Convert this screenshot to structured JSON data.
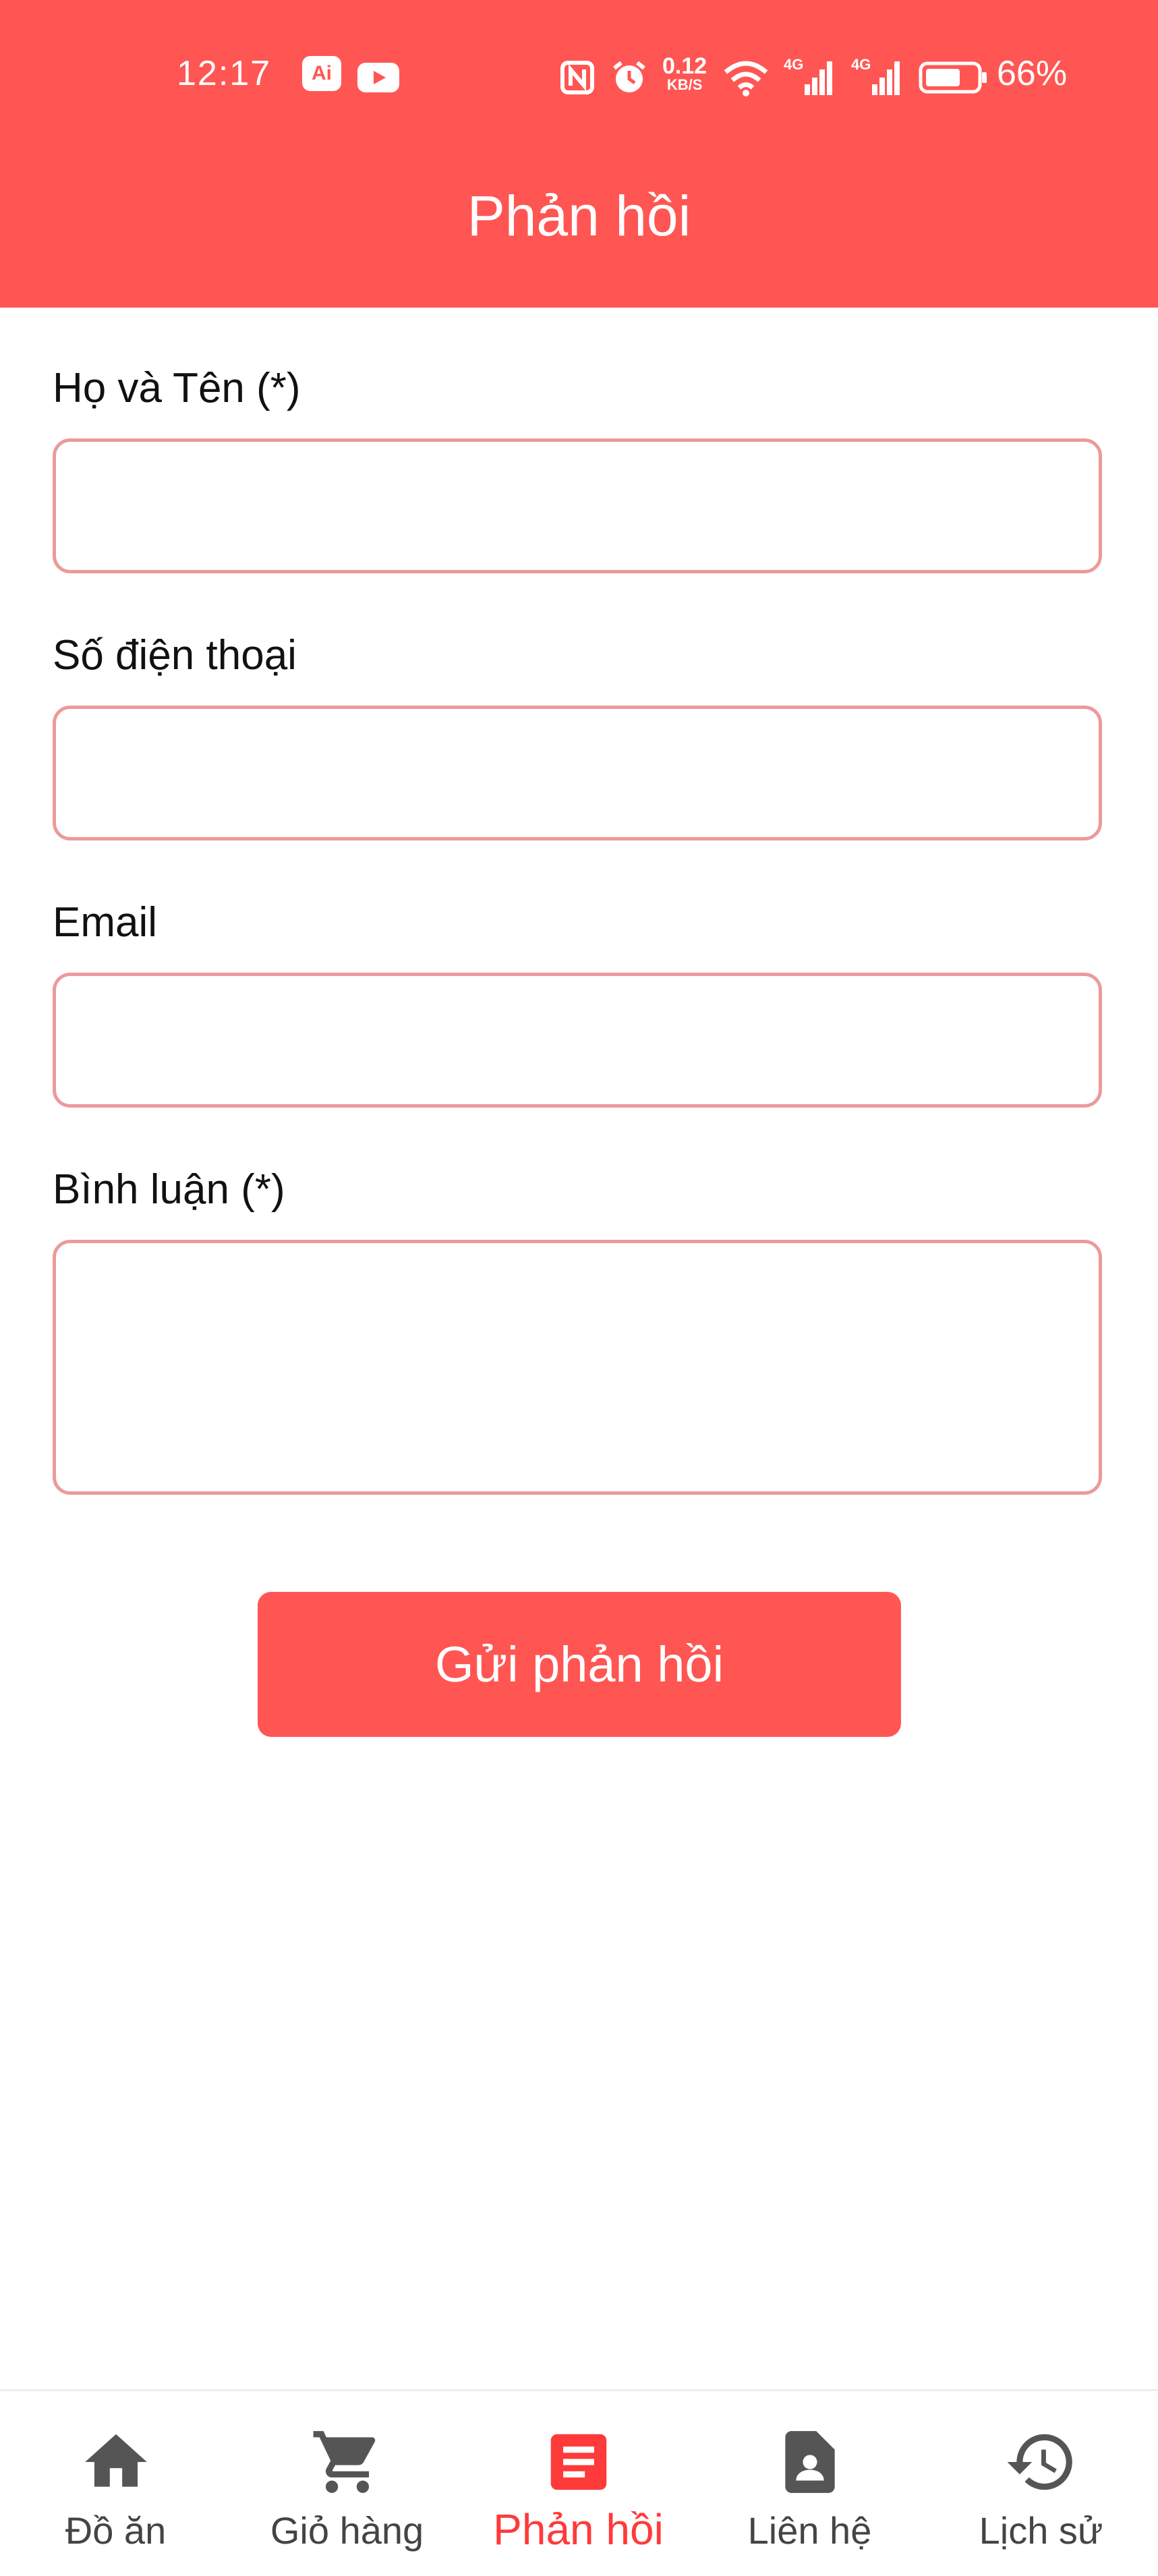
{
  "status_bar": {
    "time": "12:17",
    "app_badge": "Ai",
    "net_speed_value": "0.12",
    "net_speed_unit": "KB/S",
    "sim1": "4G",
    "sim2": "4G",
    "battery": "66%"
  },
  "header": {
    "title": "Phản hồi"
  },
  "form": {
    "name_label": "Họ và Tên (*)",
    "name_value": "",
    "phone_label": "Số điện thoại",
    "phone_value": "",
    "email_label": "Email",
    "email_value": "",
    "comment_label": "Bình luận (*)",
    "comment_value": "",
    "submit_label": "Gửi phản hồi"
  },
  "nav": {
    "items": [
      {
        "label": "Đồ ăn",
        "icon": "home-icon"
      },
      {
        "label": "Giỏ hàng",
        "icon": "cart-icon"
      },
      {
        "label": "Phản hồi",
        "icon": "feedback-icon",
        "active": true
      },
      {
        "label": "Liên hệ",
        "icon": "contact-icon"
      },
      {
        "label": "Lịch sử",
        "icon": "history-icon"
      }
    ]
  },
  "colors": {
    "accent": "#ff5653",
    "active_nav": "#ff3a3a",
    "field_border": "#ec9a9a",
    "inactive_icon": "#555555"
  }
}
